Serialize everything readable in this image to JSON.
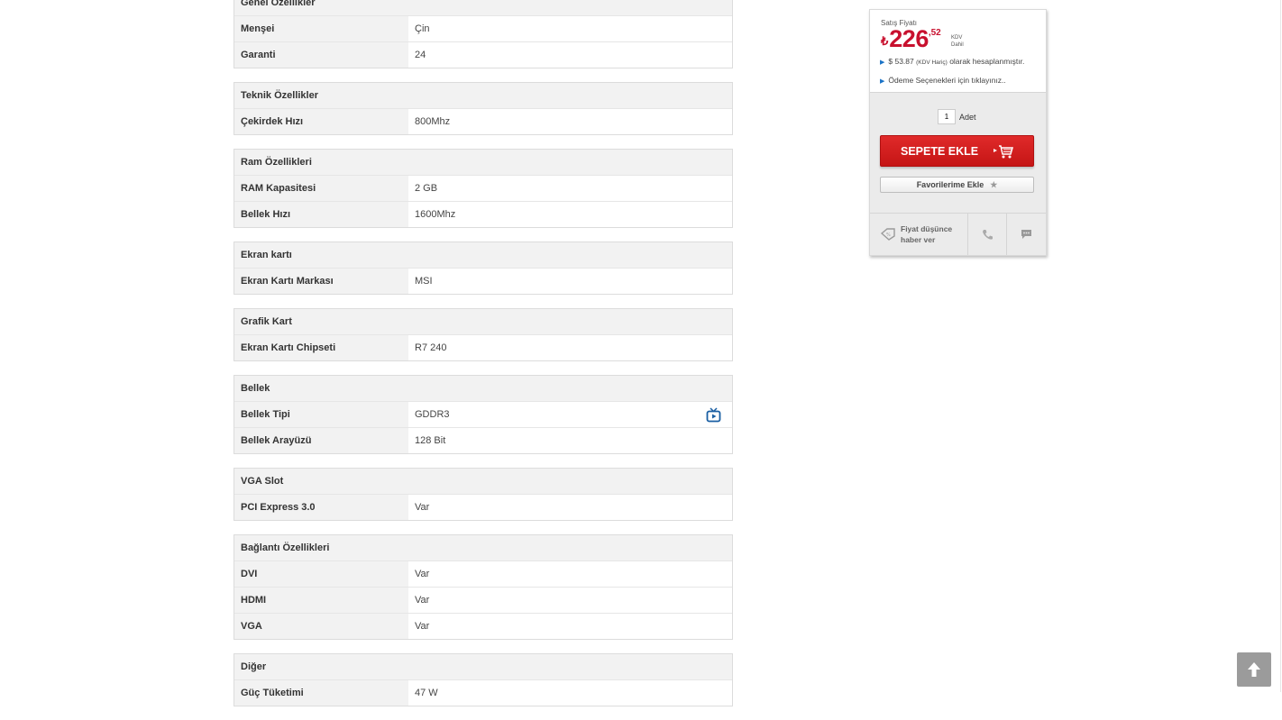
{
  "specs": [
    {
      "title": "Genel Özellikler",
      "rows": [
        {
          "key": "Menşei",
          "value": "Çin"
        },
        {
          "key": "Garanti",
          "value": "24"
        }
      ]
    },
    {
      "title": "Teknik Özellikler",
      "rows": [
        {
          "key": "Çekirdek Hızı",
          "value": "800Mhz"
        }
      ]
    },
    {
      "title": "Ram Özellikleri",
      "rows": [
        {
          "key": "RAM Kapasitesi",
          "value": "2 GB"
        },
        {
          "key": "Bellek Hızı",
          "value": "1600Mhz"
        }
      ]
    },
    {
      "title": "Ekran kartı",
      "rows": [
        {
          "key": "Ekran Kartı Markası",
          "value": "MSI"
        }
      ]
    },
    {
      "title": "Grafik Kart",
      "rows": [
        {
          "key": "Ekran Kartı Chipseti",
          "value": "R7 240"
        }
      ]
    },
    {
      "title": "Bellek",
      "rows": [
        {
          "key": "Bellek Tipi",
          "value": "GDDR3",
          "icon": "tv-play-icon"
        },
        {
          "key": "Bellek Arayüzü",
          "value": "128 Bit"
        }
      ]
    },
    {
      "title": "VGA Slot",
      "rows": [
        {
          "key": "PCI Express 3.0",
          "value": "Var"
        }
      ]
    },
    {
      "title": "Bağlantı Özellikleri",
      "rows": [
        {
          "key": "DVI",
          "value": "Var"
        },
        {
          "key": "HDMI",
          "value": "Var"
        },
        {
          "key": "VGA",
          "value": "Var"
        }
      ]
    },
    {
      "title": "Diğer",
      "rows": [
        {
          "key": "Güç Tüketimi",
          "value": "47 W"
        }
      ]
    }
  ],
  "price": {
    "label": "Satış Fiyatı",
    "currency": "₺",
    "integer": "226",
    "decimal": ",52",
    "kdv_line1": "KDV",
    "kdv_line2": "Dahil",
    "usd_prefix": "$ 53.87",
    "usd_small": "(KDV Hariç)",
    "usd_suffix": "olarak hesaplanmıştır.",
    "payment_link": "Ödeme Seçenekleri için tıklayınız..",
    "quantity": "1",
    "quantity_unit": "Adet",
    "add_to_cart": "SEPETE EKLE",
    "add_favorites": "Favorilerime Ekle",
    "price_alert_line1": "Fiyat düşünce",
    "price_alert_line2": "haber ver"
  },
  "colors": {
    "accent": "#c8102e",
    "link_arrow": "#1a73c7",
    "icon_blue": "#1a5fa3"
  }
}
